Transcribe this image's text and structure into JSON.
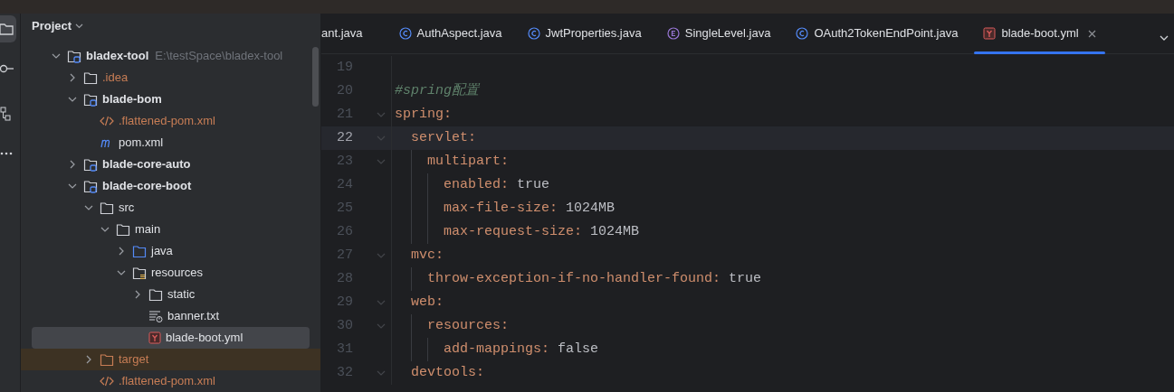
{
  "tool_strip": [
    {
      "kind": "project",
      "selected": true
    },
    {
      "kind": "commit",
      "selected": false
    },
    {
      "kind": "structure",
      "selected": false
    },
    {
      "kind": "more",
      "selected": false
    }
  ],
  "project_panel": {
    "title": "Project",
    "tree": [
      {
        "label": "bladex-tool",
        "hint": "E:\\testSpace\\bladex-tool",
        "kind": "module",
        "expanded": true,
        "selected": false,
        "ignored": false,
        "excluded": false,
        "children": [
          {
            "label": ".idea",
            "kind": "folder",
            "expanded": false,
            "selected": false,
            "ignored": true,
            "excluded": false
          },
          {
            "label": "blade-bom",
            "kind": "module",
            "expanded": true,
            "selected": false,
            "ignored": false,
            "excluded": false,
            "children": [
              {
                "label": ".flattened-pom.xml",
                "kind": "xml",
                "selected": false,
                "ignored": true,
                "excluded": false
              },
              {
                "label": "pom.xml",
                "kind": "maven",
                "selected": false,
                "ignored": false,
                "excluded": false
              }
            ]
          },
          {
            "label": "blade-core-auto",
            "kind": "module",
            "expanded": false,
            "selected": false,
            "ignored": false,
            "excluded": false
          },
          {
            "label": "blade-core-boot",
            "kind": "module",
            "expanded": true,
            "selected": false,
            "ignored": false,
            "excluded": false,
            "children": [
              {
                "label": "src",
                "kind": "folder",
                "expanded": true,
                "selected": false,
                "ignored": false,
                "excluded": false,
                "children": [
                  {
                    "label": "main",
                    "kind": "folder",
                    "expanded": true,
                    "selected": false,
                    "ignored": false,
                    "excluded": false,
                    "children": [
                      {
                        "label": "java",
                        "kind": "source",
                        "expanded": false,
                        "selected": false,
                        "ignored": false,
                        "excluded": false
                      },
                      {
                        "label": "resources",
                        "kind": "resources",
                        "expanded": true,
                        "selected": false,
                        "ignored": false,
                        "excluded": false,
                        "children": [
                          {
                            "label": "static",
                            "kind": "folder",
                            "expanded": false,
                            "selected": false,
                            "ignored": false,
                            "excluded": false
                          },
                          {
                            "label": "banner.txt",
                            "kind": "text",
                            "selected": false,
                            "ignored": false,
                            "excluded": false
                          },
                          {
                            "label": "blade-boot.yml",
                            "kind": "yaml",
                            "selected": true,
                            "ignored": false,
                            "excluded": false
                          }
                        ]
                      }
                    ]
                  }
                ]
              },
              {
                "label": "target",
                "kind": "folder",
                "expanded": false,
                "selected": false,
                "ignored": false,
                "excluded": true
              },
              {
                "label": ".flattened-pom.xml",
                "kind": "xml",
                "selected": false,
                "ignored": true,
                "excluded": false
              }
            ]
          }
        ]
      }
    ]
  },
  "tabs": [
    {
      "label": "ant.java",
      "kind": "plain",
      "selected": false
    },
    {
      "label": "AuthAspect.java",
      "kind": "class",
      "selected": false
    },
    {
      "label": "JwtProperties.java",
      "kind": "class",
      "selected": false
    },
    {
      "label": "SingleLevel.java",
      "kind": "enum",
      "selected": false
    },
    {
      "label": "OAuth2TokenEndPoint.java",
      "kind": "class",
      "selected": false
    },
    {
      "label": "blade-boot.yml",
      "kind": "yaml",
      "selected": true
    }
  ],
  "editor": {
    "lines": [
      {
        "number": "19",
        "current": false,
        "foldable": false
      },
      {
        "number": "20",
        "current": false,
        "foldable": false,
        "comment": "#spring配置"
      },
      {
        "number": "21",
        "current": false,
        "foldable": true,
        "key": "spring:",
        "children": [
          {
            "number": "22",
            "current": true,
            "foldable": true,
            "key": "servlet:",
            "children": [
              {
                "number": "23",
                "current": false,
                "foldable": true,
                "key": "multipart:",
                "children": [
                  {
                    "number": "24",
                    "current": false,
                    "foldable": false,
                    "key": "enabled:",
                    "value": "true"
                  },
                  {
                    "number": "25",
                    "current": false,
                    "foldable": false,
                    "key": "max-file-size:",
                    "value": "1024MB"
                  },
                  {
                    "number": "26",
                    "current": false,
                    "foldable": false,
                    "key": "max-request-size:",
                    "value": "1024MB"
                  }
                ]
              }
            ]
          },
          {
            "number": "27",
            "current": false,
            "foldable": true,
            "key": "mvc:",
            "children": [
              {
                "number": "28",
                "current": false,
                "foldable": false,
                "key": "throw-exception-if-no-handler-found:",
                "value": "true"
              }
            ]
          },
          {
            "number": "29",
            "current": false,
            "foldable": true,
            "key": "web:",
            "children": [
              {
                "number": "30",
                "current": false,
                "foldable": true,
                "key": "resources:",
                "children": [
                  {
                    "number": "31",
                    "current": false,
                    "foldable": false,
                    "key": "add-mappings:",
                    "value": "false"
                  }
                ]
              }
            ]
          },
          {
            "number": "32",
            "current": false,
            "foldable": true,
            "key": "devtools:"
          }
        ]
      }
    ]
  }
}
